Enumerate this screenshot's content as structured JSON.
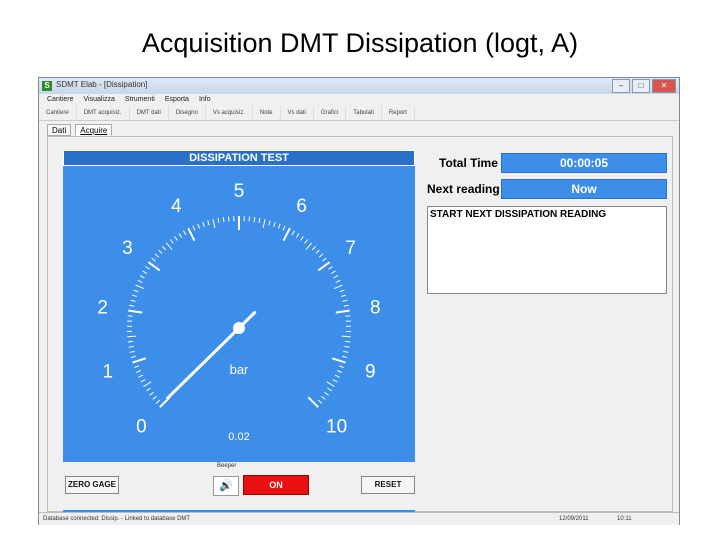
{
  "slide": {
    "title": "Acquisition DMT Dissipation (logt, A)"
  },
  "window": {
    "title": "SDMT Elab - [Dissipation]",
    "menu": [
      "Cantiere",
      "Visualizza",
      "Strumenti",
      "Esporta",
      "Info"
    ],
    "toolbar": [
      "Cantiere",
      "DMT acquisiz.",
      "DMT dati",
      "Disegno",
      "Vs acquisiz.",
      "Note",
      "Vs dati",
      "Grafici",
      "Tabulati",
      "Report"
    ],
    "tabs": [
      "Dati",
      "Acquire"
    ],
    "active_tab": "Acquire"
  },
  "gauge": {
    "header": "DISSIPATION TEST",
    "scale_labels": [
      "0",
      "1",
      "2",
      "3",
      "4",
      "5",
      "6",
      "7",
      "8",
      "9",
      "10"
    ],
    "unit": "bar",
    "reading": "0.02",
    "value": 0.02,
    "min": 0,
    "max": 10,
    "colors": {
      "face": "#3d8ee8",
      "marks": "#ffffff",
      "header": "#2a6fc9"
    }
  },
  "info": {
    "total_time_label": "Total Time",
    "total_time_value": "00:00:05",
    "next_reading_label": "Next reading",
    "next_reading_value": "Now",
    "message": "START NEXT DISSIPATION READING"
  },
  "controls": {
    "zero_gage": "ZERO GAGE",
    "beeper_label": "Beeper",
    "beeper_icon": "speaker-icon",
    "on_button": "ON",
    "reset": "RESET"
  },
  "status": {
    "left": "Database connected: Dissip. - Linked to database DMT",
    "date": "12/09/2011",
    "time": "10:11"
  }
}
